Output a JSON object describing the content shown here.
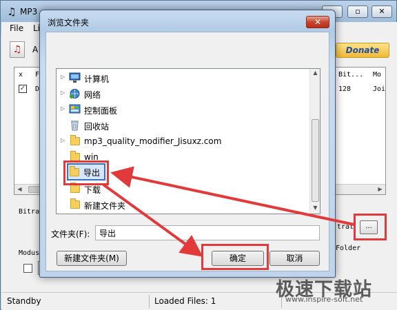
{
  "main_window": {
    "app_icon": "music-note-icon",
    "title": "MP3",
    "menu": [
      "File",
      "Li"
    ],
    "toolbar_add": "A",
    "donate": "Donate",
    "table": {
      "columns": [
        "x",
        "F",
        "Bit...",
        "Mo"
      ],
      "row": {
        "checked": "✓",
        "name": "D",
        "bitrate": "128",
        "mode": "Joi"
      }
    },
    "labels": {
      "bitrate": "Bitra",
      "strat": "trat",
      "folder": "Folder",
      "modus": "Modus"
    },
    "browse_button": "...",
    "status": {
      "state": "Standby",
      "loaded": "Loaded Files: 1"
    }
  },
  "watermark": {
    "text": "极速下载站",
    "url": "www.inspire-soft.net"
  },
  "dialog": {
    "title": "浏览文件夹",
    "close": "✕",
    "tree": [
      {
        "label": "计算机",
        "icon": "computer-icon",
        "expandable": true
      },
      {
        "label": "网络",
        "icon": "network-icon",
        "expandable": true
      },
      {
        "label": "控制面板",
        "icon": "control-panel-icon",
        "expandable": true
      },
      {
        "label": "回收站",
        "icon": "recycle-bin-icon",
        "expandable": false
      },
      {
        "label": "mp3_quality_modifier_Jisuxz.com",
        "icon": "folder-icon",
        "expandable": true
      },
      {
        "label": "win",
        "icon": "folder-icon",
        "expandable": false
      },
      {
        "label": "导出",
        "icon": "folder-icon",
        "expandable": false,
        "selected": true
      },
      {
        "label": "下载",
        "icon": "folder-icon",
        "expandable": false
      },
      {
        "label": "新建文件夹",
        "icon": "folder-icon",
        "expandable": false
      }
    ],
    "folder_label": "文件夹(F):",
    "folder_value": "导出",
    "buttons": {
      "new_folder": "新建文件夹(M)",
      "ok": "确定",
      "cancel": "取消"
    }
  },
  "annotation_color": "#e23a3a"
}
